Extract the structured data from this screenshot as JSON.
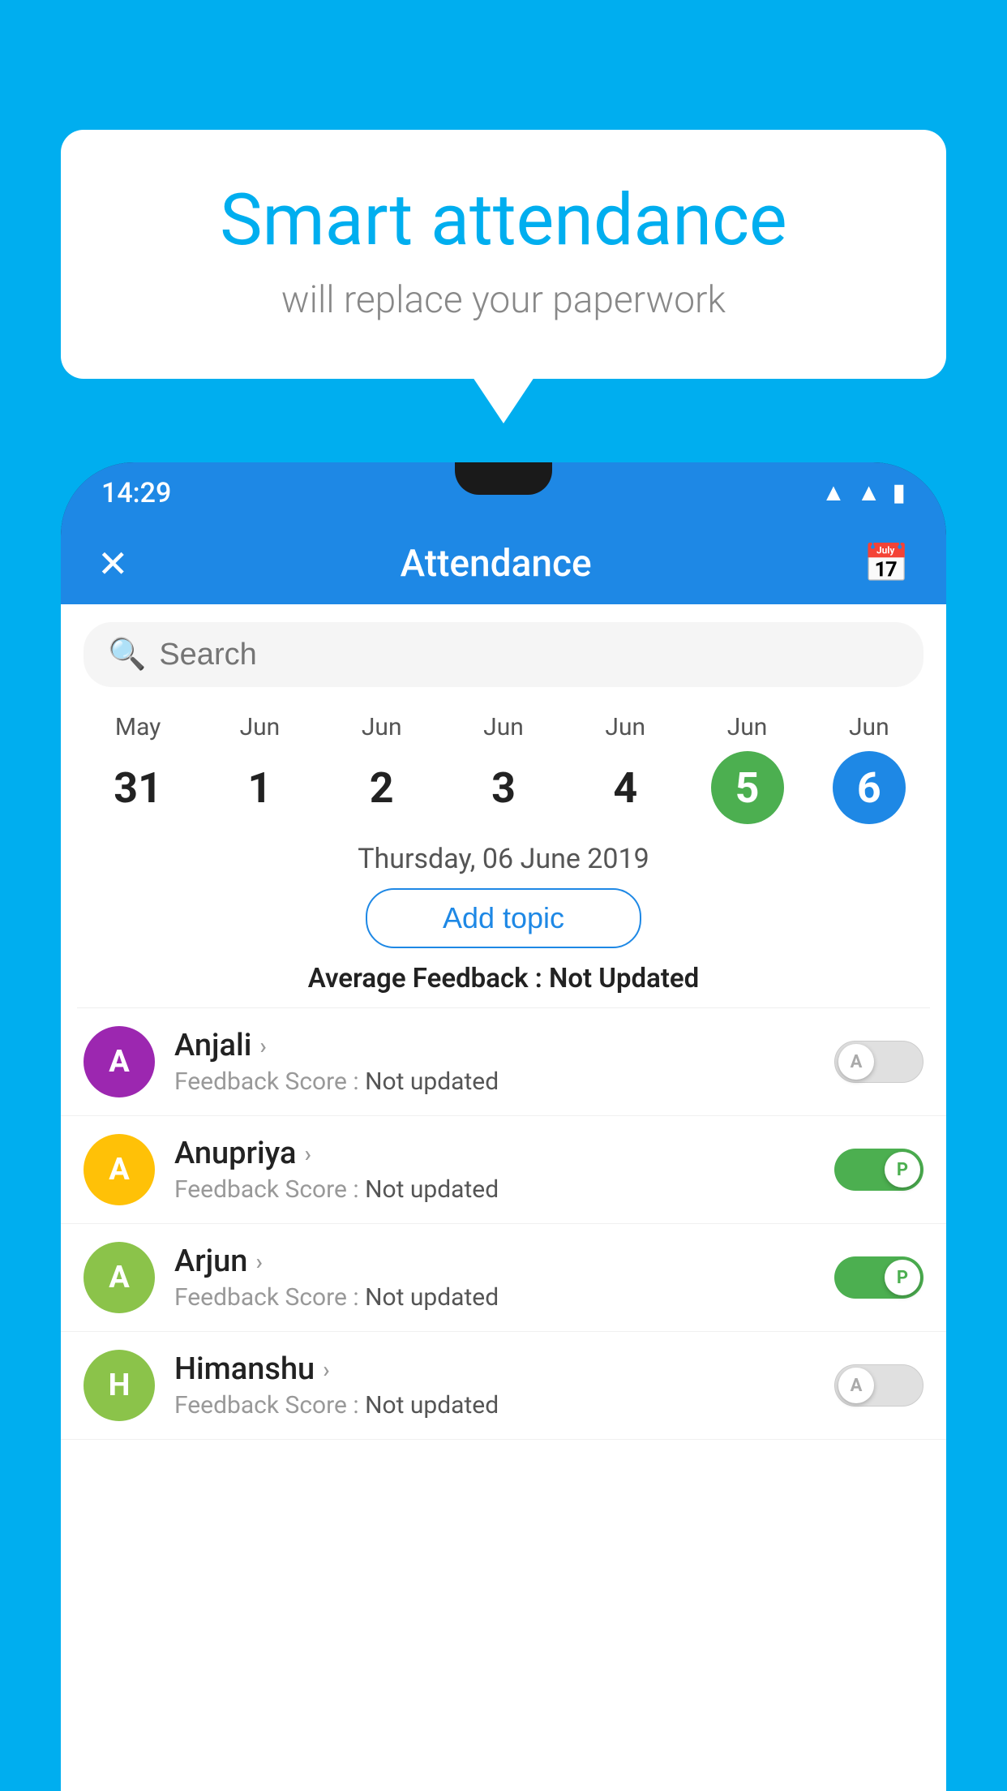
{
  "background_color": "#00AEEF",
  "speech_bubble": {
    "main_title": "Smart attendance",
    "sub_title": "will replace your paperwork"
  },
  "status_bar": {
    "time": "14:29"
  },
  "app_bar": {
    "title": "Attendance",
    "close_icon": "✕",
    "calendar_icon": "📅"
  },
  "search": {
    "placeholder": "Search"
  },
  "calendar": {
    "days": [
      {
        "month": "May",
        "day": "31",
        "state": "normal"
      },
      {
        "month": "Jun",
        "day": "1",
        "state": "normal"
      },
      {
        "month": "Jun",
        "day": "2",
        "state": "normal"
      },
      {
        "month": "Jun",
        "day": "3",
        "state": "normal"
      },
      {
        "month": "Jun",
        "day": "4",
        "state": "normal"
      },
      {
        "month": "Jun",
        "day": "5",
        "state": "today"
      },
      {
        "month": "Jun",
        "day": "6",
        "state": "selected"
      }
    ]
  },
  "date_header": "Thursday, 06 June 2019",
  "add_topic_label": "Add topic",
  "average_feedback_label": "Average Feedback :",
  "average_feedback_value": "Not Updated",
  "students": [
    {
      "name": "Anjali",
      "avatar_letter": "A",
      "avatar_color": "#9C27B0",
      "feedback_label": "Feedback Score :",
      "feedback_value": "Not updated",
      "toggle_state": "off",
      "toggle_label": "A"
    },
    {
      "name": "Anupriya",
      "avatar_letter": "A",
      "avatar_color": "#FFC107",
      "feedback_label": "Feedback Score :",
      "feedback_value": "Not updated",
      "toggle_state": "on",
      "toggle_label": "P"
    },
    {
      "name": "Arjun",
      "avatar_letter": "A",
      "avatar_color": "#8BC34A",
      "feedback_label": "Feedback Score :",
      "feedback_value": "Not updated",
      "toggle_state": "on",
      "toggle_label": "P"
    },
    {
      "name": "Himanshu",
      "avatar_letter": "H",
      "avatar_color": "#8BC34A",
      "feedback_label": "Feedback Score :",
      "feedback_value": "Not updated",
      "toggle_state": "off",
      "toggle_label": "A"
    }
  ]
}
